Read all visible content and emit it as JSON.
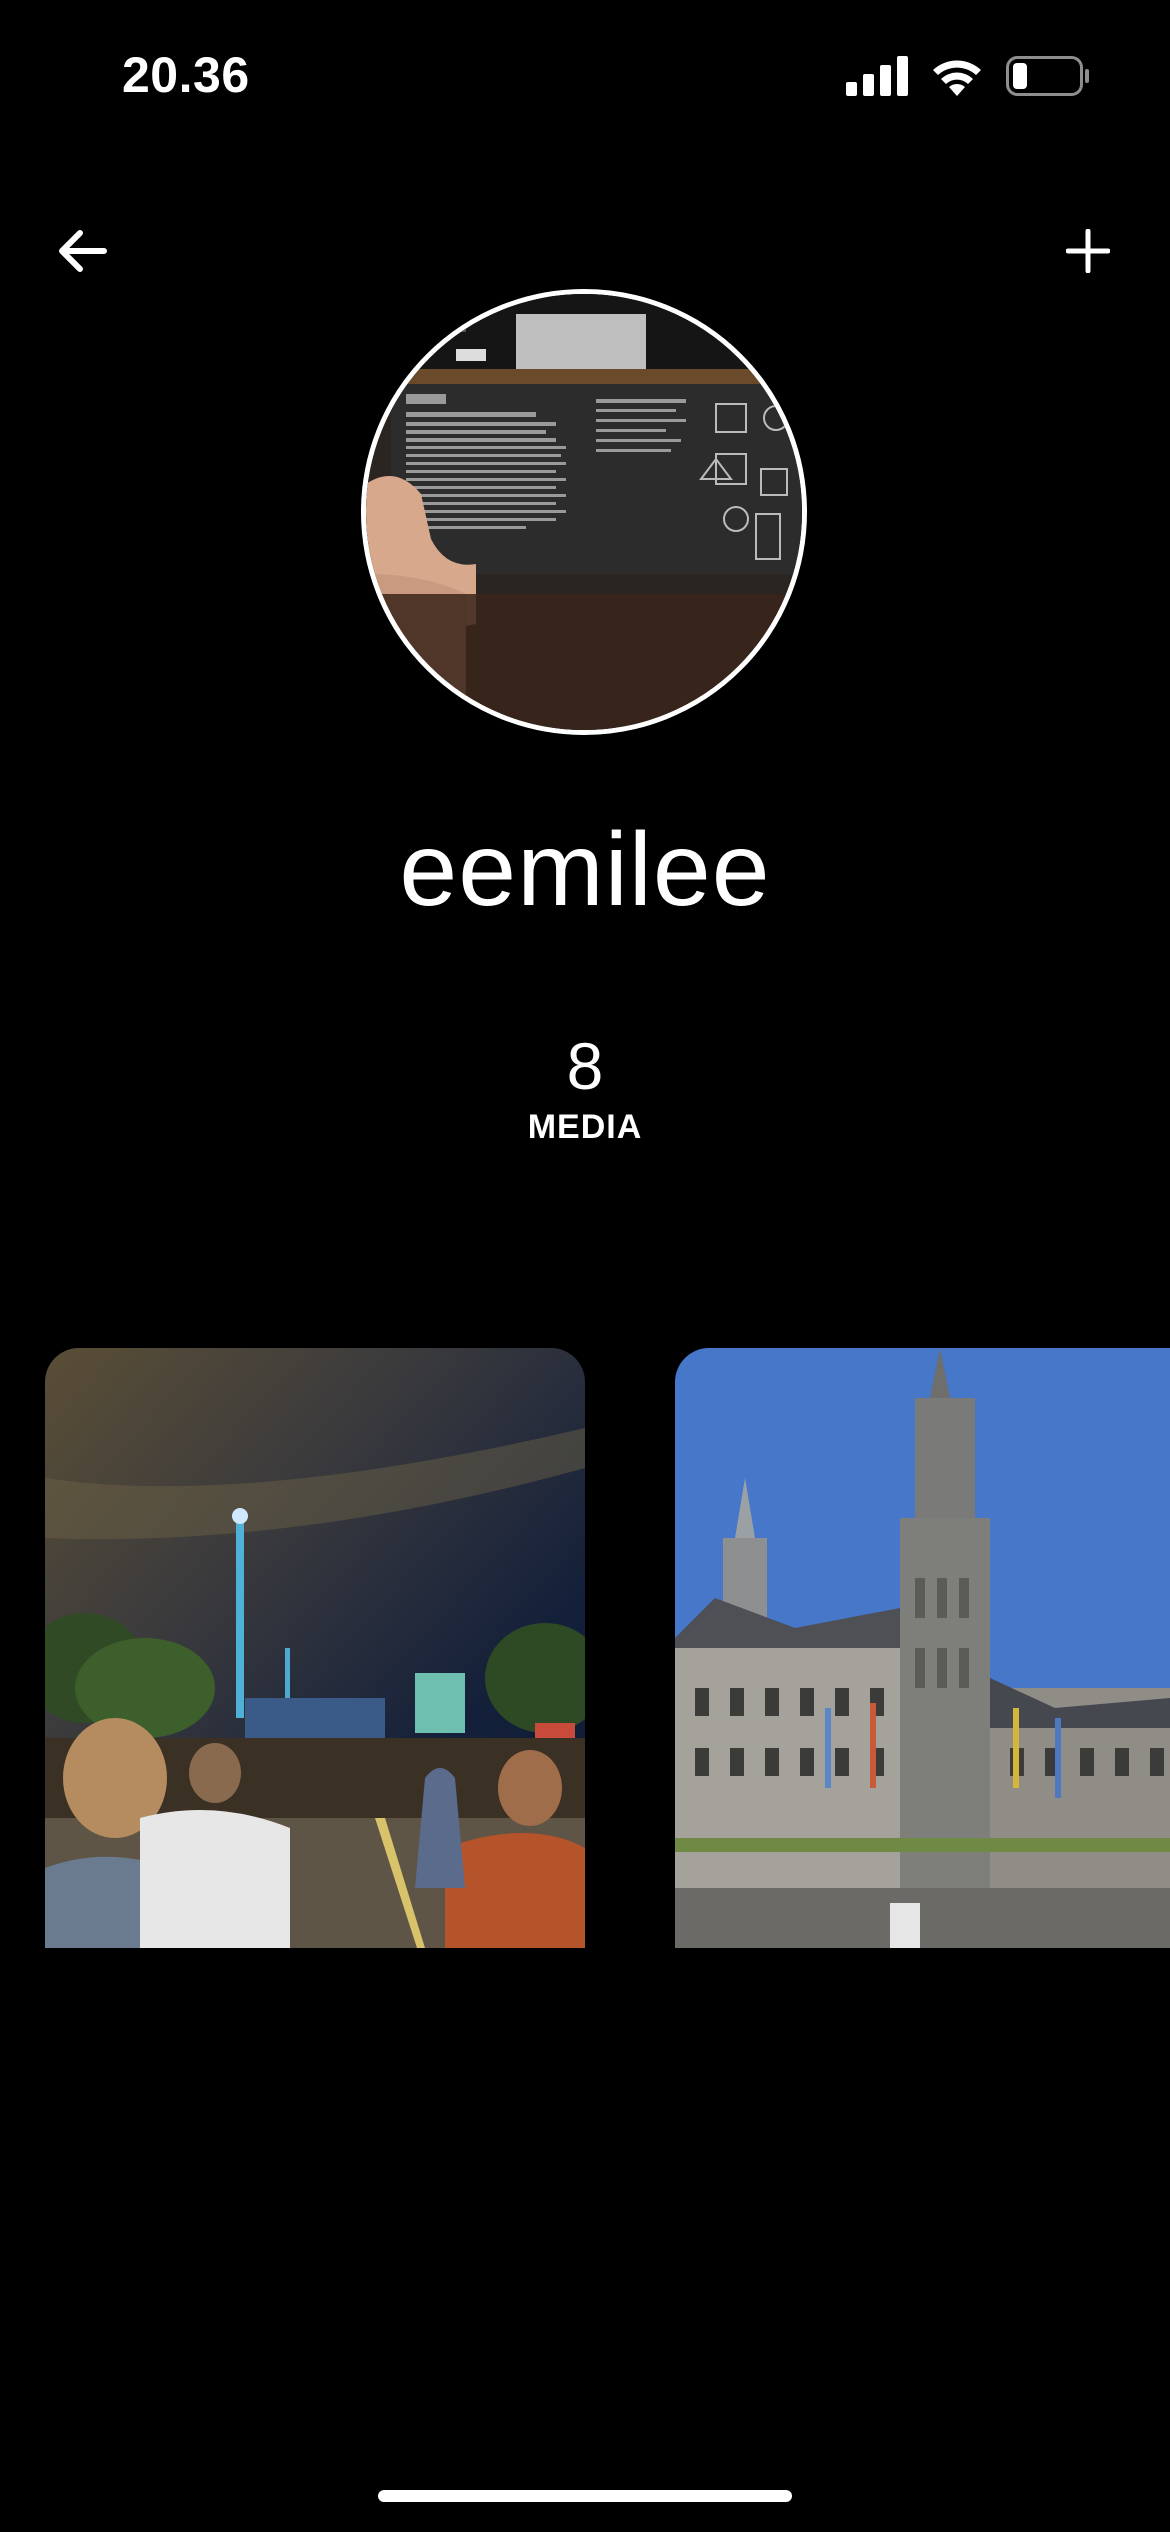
{
  "status_bar": {
    "time": "20.36",
    "icons": [
      "signal-icon",
      "wifi-icon",
      "battery-icon"
    ],
    "battery_level": 0.2
  },
  "nav": {
    "back_icon": "arrow-left-icon",
    "add_icon": "plus-icon"
  },
  "profile": {
    "username": "eemilee",
    "avatar": "avatar-photo",
    "media_count": "8",
    "media_label": "MEDIA"
  },
  "media": [
    {
      "name": "media-thumbnail-festival-night"
    },
    {
      "name": "media-thumbnail-town-hall"
    }
  ],
  "colors": {
    "background": "#000000",
    "foreground": "#ffffff"
  }
}
